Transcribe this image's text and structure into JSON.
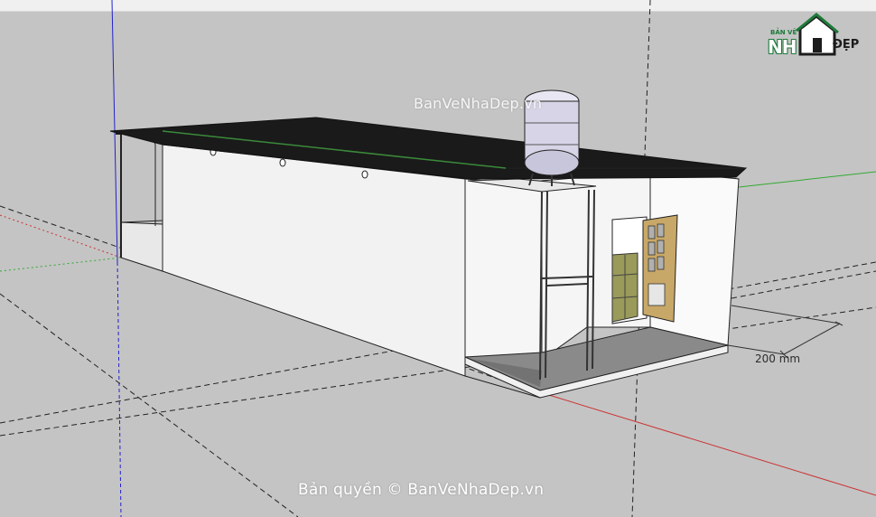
{
  "viewport": {
    "dimension_label": "200 mm"
  },
  "watermarks": {
    "top": "BanVeNhaDep.vn",
    "bottom": "Bản quyền © BanVeNhaDep.vn"
  },
  "logo": {
    "top_text": "BẢN VẼ",
    "main_text": "NH",
    "end_text": "ĐẸP"
  },
  "colors": {
    "background": "#c4c4c4",
    "red_axis": "#cc3333",
    "green_axis": "#33aa33",
    "blue_axis": "#2222cc",
    "roof": "#1a1a1a",
    "wall": "#f2f2f2",
    "floor": "#8a8a8a",
    "door": "#c8a868",
    "window_panel": "#9a9a5a",
    "water_tank": "#d6d4e6",
    "logo_green": "#1d7a3a"
  }
}
